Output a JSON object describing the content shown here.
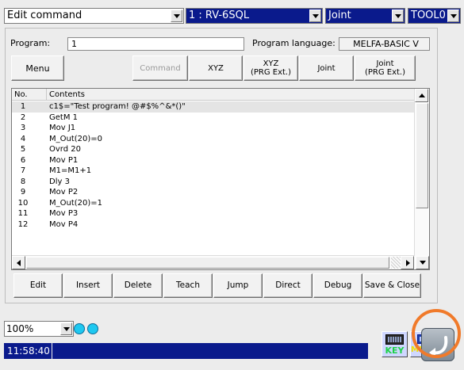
{
  "topbar": {
    "mode": "Edit command",
    "robot": "1 : RV-6SQL",
    "jog_mode": "Joint",
    "tool": "TOOL0"
  },
  "program": {
    "label": "Program:",
    "value": "1",
    "language_label": "Program language:",
    "language_value": "MELFA-BASIC V"
  },
  "toolbar": {
    "menu": "Menu",
    "command": "Command",
    "xyz": "XYZ",
    "xyz_ext": "XYZ\n(PRG Ext.)",
    "joint": "Joint",
    "joint_ext": "Joint\n(PRG Ext.)"
  },
  "table": {
    "col_no": "No.",
    "col_contents": "Contents",
    "rows": [
      {
        "no": "1",
        "text": "c1$=\"Test program! @#$%^&*()\""
      },
      {
        "no": "2",
        "text": "GetM 1"
      },
      {
        "no": "3",
        "text": "Mov J1"
      },
      {
        "no": "4",
        "text": "M_Out(20)=0"
      },
      {
        "no": "5",
        "text": "Ovrd 20"
      },
      {
        "no": "6",
        "text": "Mov P1"
      },
      {
        "no": "7",
        "text": "M1=M1+1"
      },
      {
        "no": "8",
        "text": "Dly 3"
      },
      {
        "no": "9",
        "text": "Mov P2"
      },
      {
        "no": "10",
        "text": "M_Out(20)=1"
      },
      {
        "no": "11",
        "text": "Mov P3"
      },
      {
        "no": "12",
        "text": "Mov P4"
      }
    ]
  },
  "actions": {
    "edit": "Edit",
    "insert": "Insert",
    "delete": "Delete",
    "teach": "Teach",
    "jump": "Jump",
    "direct": "Direct",
    "debug": "Debug",
    "save_close": "Save & Close"
  },
  "status": {
    "zoom": "100%",
    "time": "11:58:40",
    "key_label": "KEY",
    "menu_label": "MENU"
  },
  "colors": {
    "accent_blue": "#0a1a8c",
    "led": "#1ec8f0",
    "highlight": "#f07a2a"
  }
}
